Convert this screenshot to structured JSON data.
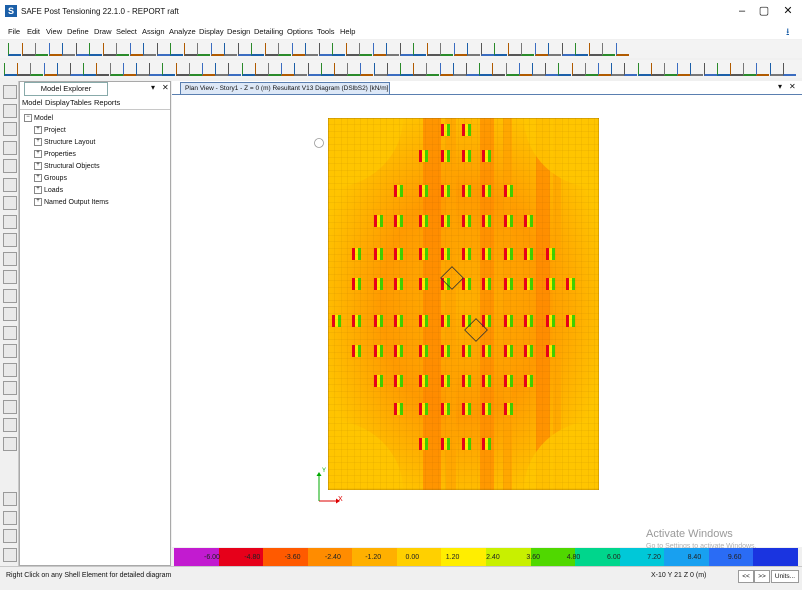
{
  "window": {
    "title": "SAFE Post Tensioning 22.1.0 - REPORT raft",
    "app_icon_letter": "S",
    "minimize": "–",
    "maximize": "▢",
    "close": "✕"
  },
  "menu": [
    "File",
    "Edit",
    "View",
    "Define",
    "Draw",
    "Select",
    "Assign",
    "Analyze",
    "Display",
    "Design",
    "Detailing",
    "Options",
    "Tools",
    "Help"
  ],
  "explorer": {
    "tab_label": "Model Explorer",
    "pin": "▾",
    "close": "✕",
    "tabs": [
      "Model",
      "Display",
      "Tables",
      "Reports"
    ],
    "root": "Model",
    "items": [
      "Project",
      "Structure Layout",
      "Properties",
      "Structural Objects",
      "Groups",
      "Loads",
      "Named Output Items"
    ]
  },
  "document": {
    "tab_label": "Plan View - Story1 - Z = 0 (m)   Resultant V13 Diagram   (DSlbS2)  [kN/m]",
    "pin": "▾",
    "close": "✕"
  },
  "axes": {
    "x_label": "X",
    "y_label": "Y"
  },
  "colorbar": {
    "labels": [
      "-6.00",
      "-4.80",
      "-3.60",
      "-2.40",
      "-1.20",
      "0.00",
      "1.20",
      "2.40",
      "3.60",
      "4.80",
      "6.00",
      "7.20",
      "8.40",
      "9.60"
    ],
    "colors": [
      "#c21bd0",
      "#e6001a",
      "#ff5a00",
      "#ff8c00",
      "#ffb000",
      "#ffd000",
      "#ffee00",
      "#c8f000",
      "#50d800",
      "#00d68c",
      "#00c8d8",
      "#18a0f0",
      "#2a6cf5",
      "#1a34e0"
    ]
  },
  "watermark": {
    "line1": "Activate Windows",
    "line2": "Go to Settings to activate Windows."
  },
  "status": {
    "hint": "Right Click on any Shell Element for detailed diagram",
    "coords": "X-10  Y 21  Z 0 (m)",
    "prev": "<<",
    "next": ">>",
    "units": "Units..."
  }
}
